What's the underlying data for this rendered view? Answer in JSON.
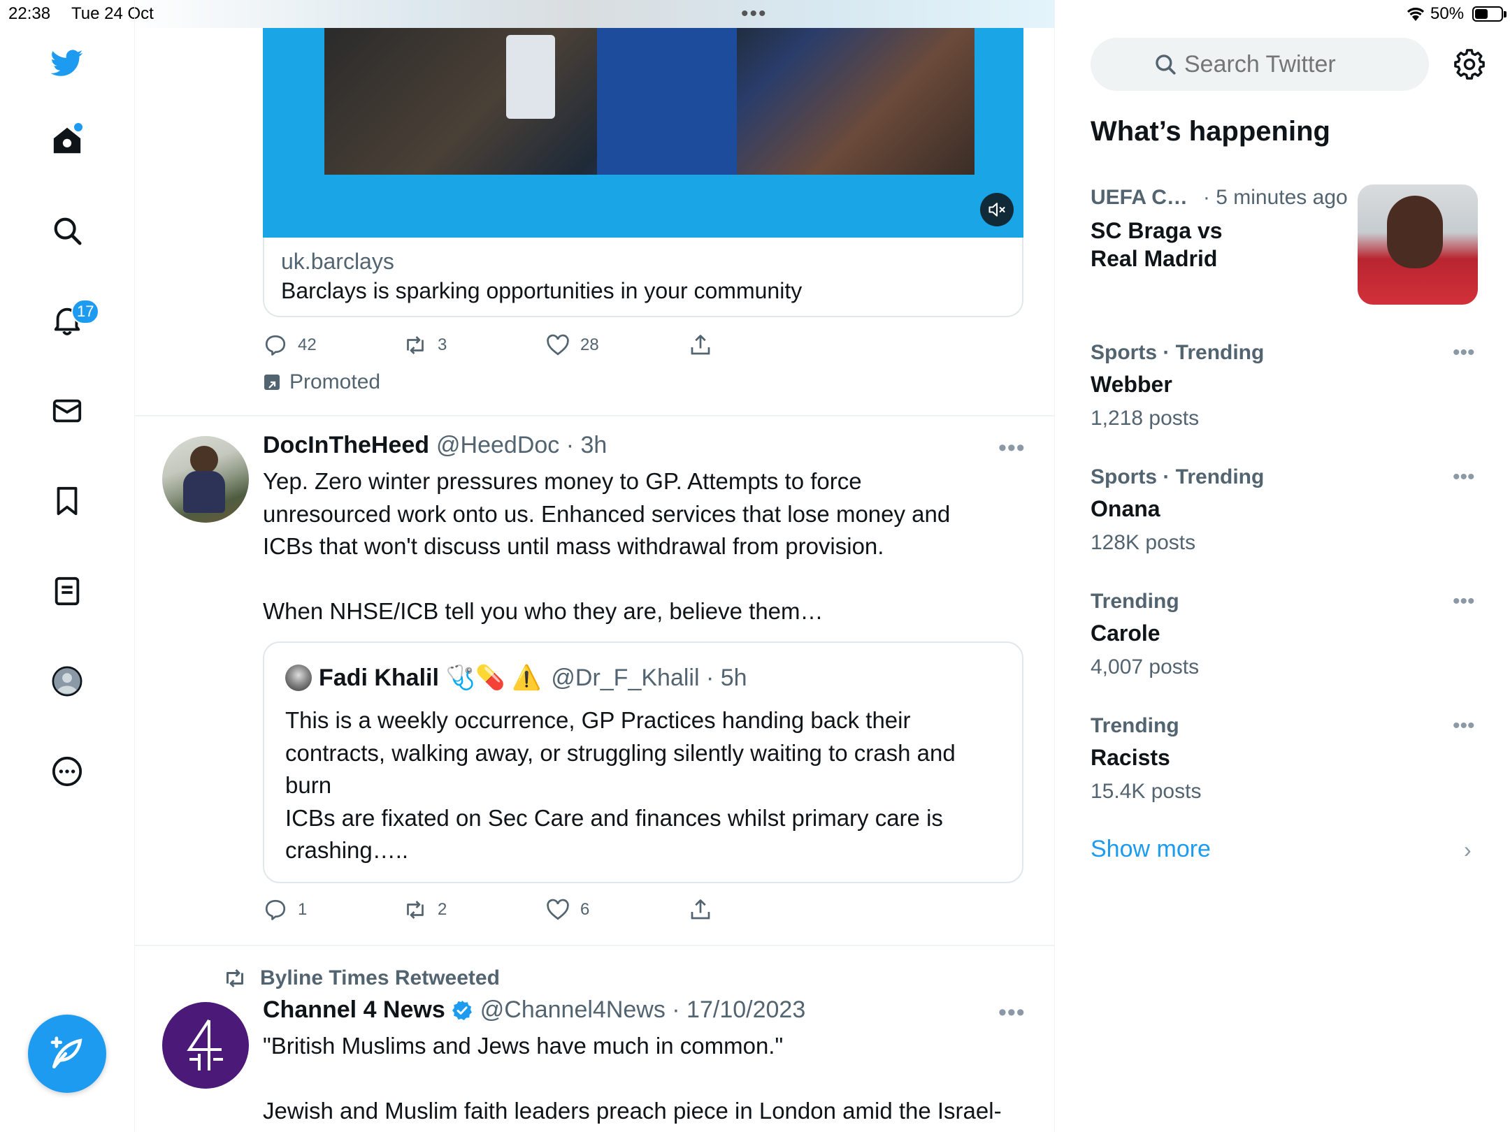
{
  "status_bar": {
    "time": "22:38",
    "date": "Tue 24 Oct",
    "battery_text": "50%",
    "battery_level": 0.5,
    "multitask": "•••"
  },
  "nav": {
    "notifications_badge": "17"
  },
  "ad": {
    "domain": "uk.barclays",
    "headline": "Barclays is sparking opportunities in your community",
    "stats": {
      "replies": "42",
      "retweets": "3",
      "likes": "28"
    },
    "promoted_label": "Promoted"
  },
  "tweet1": {
    "name": "DocInTheHeed",
    "handle_time": "@HeedDoc · 3h",
    "text_lines": [
      "Yep. Zero winter pressures money to GP. Attempts to force",
      "unresourced work onto us. Enhanced services that lose money and",
      "ICBs that won't discuss until mass withdrawal from provision.",
      "",
      "When NHSE/ICB tell you who they are, believe them…"
    ],
    "quote": {
      "name": "Fadi Khalil",
      "emoji": "🩺💊 ⚠️",
      "handle_time": "@Dr_F_Khalil · 5h",
      "text_lines": [
        "This is a weekly occurrence, GP Practices handing back their",
        "contracts, walking away, or struggling silently waiting to crash and",
        "burn",
        "ICBs are fixated on Sec Care and finances whilst primary care is",
        "crashing….."
      ]
    },
    "stats": {
      "replies": "1",
      "retweets": "2",
      "likes": "6"
    }
  },
  "tweet2": {
    "retweeted_by": "Byline Times Retweeted",
    "name": "Channel 4 News",
    "handle_time": "@Channel4News · 17/10/2023",
    "text_lines": [
      "\"British Muslims and Jews have much in common.\"",
      "",
      "Jewish and Muslim faith leaders preach piece in London amid the Israel-"
    ]
  },
  "sidebar": {
    "search_placeholder": "Search Twitter",
    "heading": "What’s happening",
    "trends": [
      {
        "meta": "UEFA C…",
        "meta_time": "· 5 minutes ago",
        "title_lines": [
          "SC Braga vs",
          "Real Madrid"
        ]
      },
      {
        "meta": "Sports · Trending",
        "title": "Webber",
        "count": "1,218 posts"
      },
      {
        "meta": "Sports · Trending",
        "title": "Onana",
        "count": "128K posts"
      },
      {
        "meta": "Trending",
        "title": "Carole",
        "count": "4,007 posts"
      },
      {
        "meta": "Trending",
        "title": "Racists",
        "count": "15.4K posts"
      }
    ],
    "show_more": "Show more",
    "more_dots": "•••",
    "chevron": "›"
  },
  "colors": {
    "accent": "#1d9bf0",
    "text": "#0f1419",
    "muted": "#536471",
    "ad_bg": "#1aa5e6",
    "channel4_purple": "#4b1a78"
  },
  "icons": [
    "twitter-bird-icon",
    "home-icon",
    "search-icon",
    "bell-icon",
    "mail-icon",
    "bookmark-icon",
    "list-icon",
    "profile-icon",
    "more-circle-icon",
    "compose-icon",
    "mute-icon",
    "reply-icon",
    "retweet-icon",
    "like-icon",
    "share-icon",
    "gear-icon",
    "verified-icon",
    "chevron-right-icon"
  ]
}
